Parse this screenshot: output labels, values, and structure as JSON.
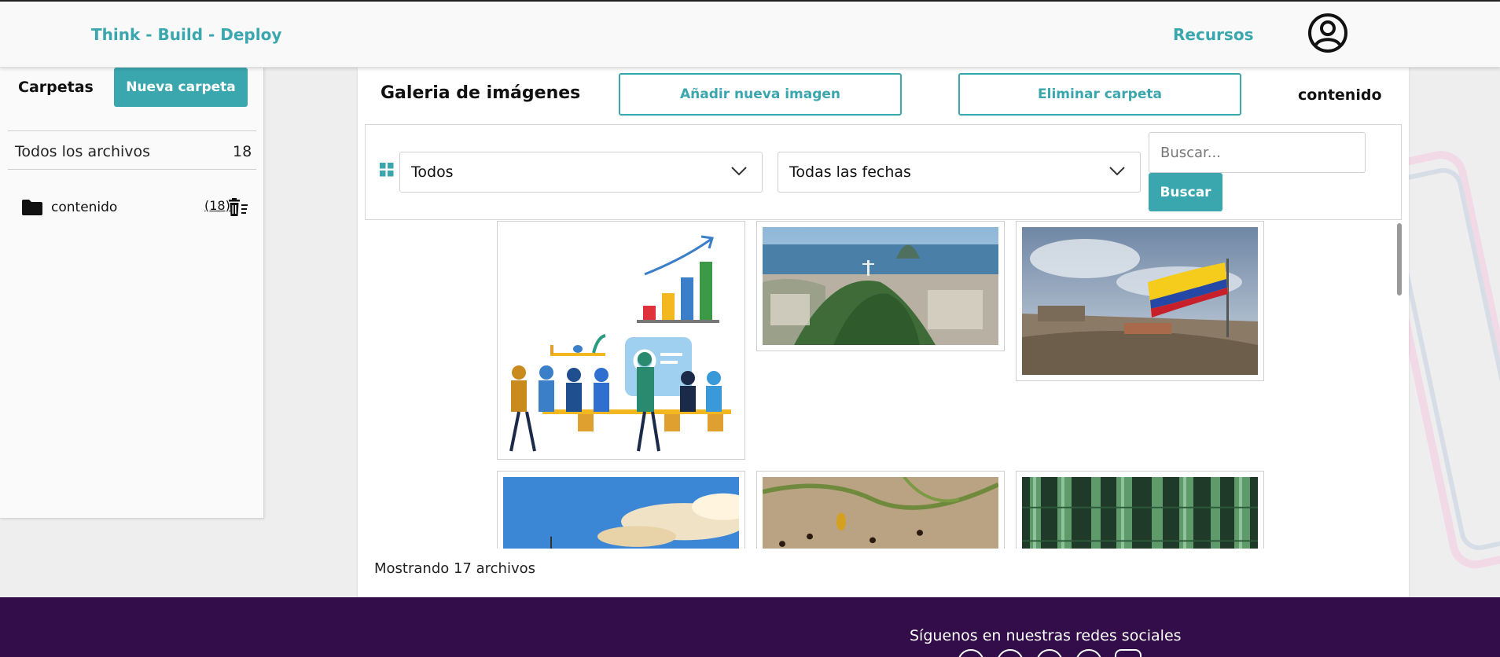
{
  "header": {
    "brand": "Think - Build - Deploy",
    "nav_link": "Recursos",
    "avatar_icon": "user-circle-icon"
  },
  "sidebar": {
    "title": "Carpetas",
    "new_folder_label": "Nueva carpeta",
    "all_files_label": "Todos los archivos",
    "all_files_count": "18",
    "folders": [
      {
        "name": "contenido",
        "count": "(18)",
        "icon": "folder-icon",
        "action_icon": "trash-icon"
      }
    ]
  },
  "main": {
    "title": "Galeria de imágenes",
    "add_image_label": "Añadir nueva imagen",
    "delete_folder_label": "Eliminar carpeta",
    "current_folder": "contenido",
    "filters": {
      "type_value": "Todos",
      "date_value": "Todas las fechas",
      "search_placeholder": "Buscar...",
      "search_button": "Buscar"
    },
    "gallery_icons": [
      "grid-view-icon"
    ],
    "status": "Mostrando 17 archivos"
  },
  "footer": {
    "social_title": "Síguenos en nuestras redes sociales"
  },
  "colors": {
    "accent": "#3aa6ad",
    "footer_bg": "#330d4a"
  }
}
